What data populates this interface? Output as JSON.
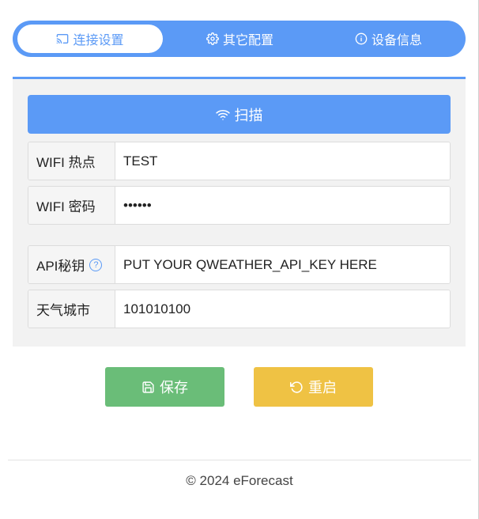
{
  "tabs": [
    {
      "label": "连接设置",
      "icon": "cast-icon",
      "active": true
    },
    {
      "label": "其它配置",
      "icon": "gear-icon",
      "active": false
    },
    {
      "label": "设备信息",
      "icon": "info-icon",
      "active": false
    }
  ],
  "scan": {
    "label": "扫描",
    "icon": "wifi-icon"
  },
  "fields": {
    "wifi_ssid": {
      "label": "WIFI 热点",
      "value": "TEST"
    },
    "wifi_password": {
      "label": "WIFI 密码",
      "value": "••••••"
    },
    "api_key": {
      "label": "API秘钥",
      "help": "?",
      "value": "PUT YOUR QWEATHER_API_KEY HERE"
    },
    "city": {
      "label": "天气城市",
      "value": "101010100"
    }
  },
  "actions": {
    "save_label": "保存",
    "save_icon": "floppy-disk-icon",
    "restart_label": "重启",
    "restart_icon": "refresh-icon"
  },
  "footer": {
    "text": "© 2024 eForecast"
  },
  "colors": {
    "primary": "#5b9af6",
    "save": "#6abd78",
    "restart": "#efc244",
    "panel_bg": "#f2f2f2"
  }
}
